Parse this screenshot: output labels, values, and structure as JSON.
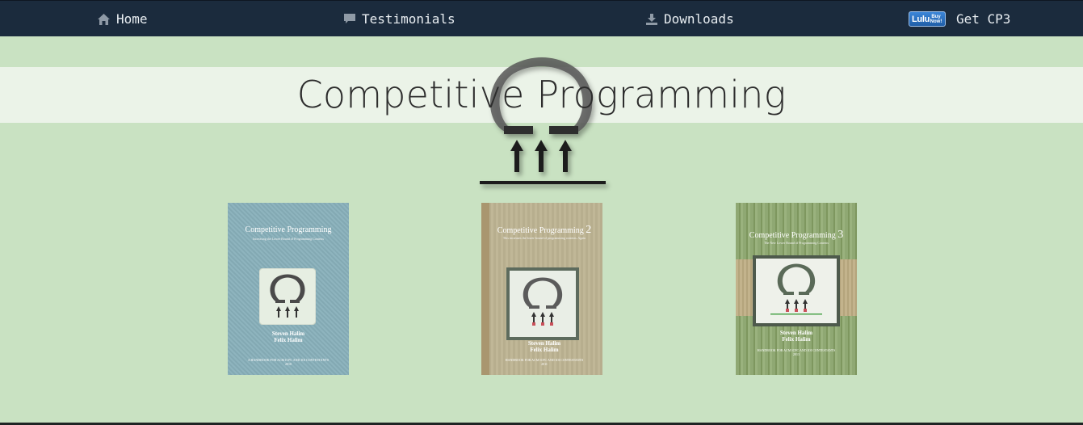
{
  "nav": {
    "home": "Home",
    "testimonials": "Testimonials",
    "downloads": "Downloads",
    "lulu_badge": {
      "brand": "Lulu",
      "cta": "Buy Now!"
    },
    "get_cp3": "Get CP3"
  },
  "hero": {
    "title": "Competitive Programming",
    "logo_icon": "omega-arrows-logo"
  },
  "books": [
    {
      "title": "Competitive Programming",
      "subtitle": "Increasing the Lower Bound of Programming Contests",
      "authors": [
        "Steven Halim",
        "Felix Halim"
      ],
      "footer": "A HANDBOOK FOR ACM ICPC AND IOI CONTESTANTS",
      "year": "2010"
    },
    {
      "title": "Competitive Programming",
      "edition": "2",
      "subtitle": "This increases the lower bound of programming contests. Again",
      "authors": [
        "Steven Halim",
        "Felix Halim"
      ],
      "footer": "HANDBOOK FOR ACM ICPC AND IOI CONTESTANTS",
      "year": "2011"
    },
    {
      "title": "Competitive Programming",
      "edition": "3",
      "subtitle": "The New Lower Bound of Programming Contests",
      "authors": [
        "Steven Halim",
        "Felix Halim"
      ],
      "footer": "HANDBOOK FOR ACM ICPC AND IOI CONTESTANTS",
      "year": "2013"
    }
  ],
  "colors": {
    "navbar": "#1b2b3d",
    "page_background": "#c9e2c2",
    "title_band": "#ebf3e8"
  }
}
